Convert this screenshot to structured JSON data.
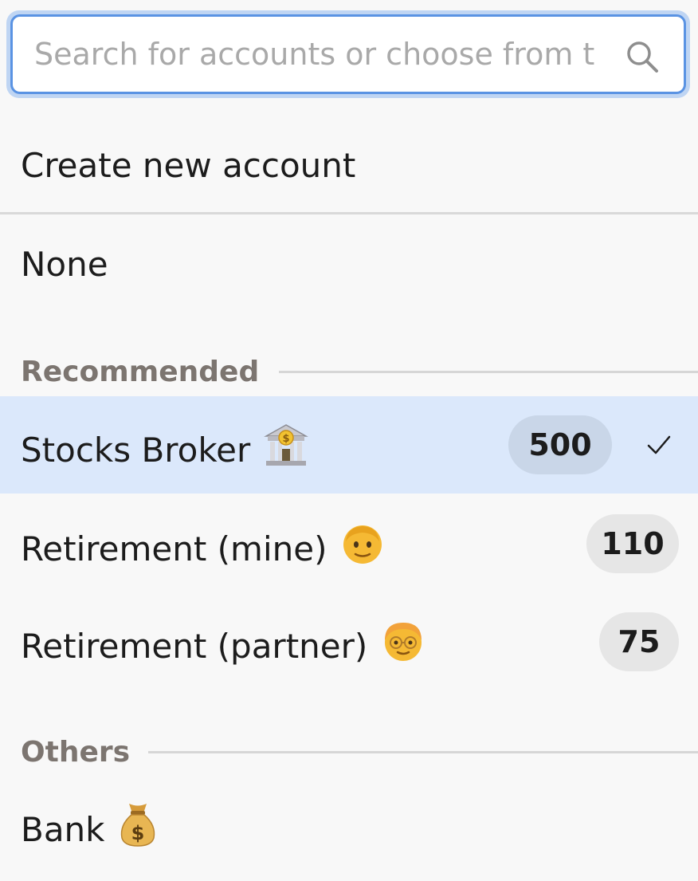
{
  "search": {
    "placeholder": "Search for accounts or choose from t"
  },
  "create_new": {
    "label": "Create new account"
  },
  "none_option": {
    "label": "None"
  },
  "sections": {
    "recommended": {
      "label": "Recommended",
      "items": [
        {
          "label": "Stocks Broker",
          "emoji": "bank-icon",
          "count": "500",
          "selected": true
        },
        {
          "label": "Retirement (mine)",
          "emoji": "older-man-icon",
          "count": "110",
          "selected": false
        },
        {
          "label": "Retirement (partner)",
          "emoji": "older-person-glasses-icon",
          "count": "75",
          "selected": false
        }
      ]
    },
    "others": {
      "label": "Others",
      "items": [
        {
          "label": "Bank",
          "emoji": "money-bag-icon"
        }
      ]
    }
  },
  "colors": {
    "accent": "#5a93e3",
    "selected_row": "#dbe8fb",
    "section_label": "#7c7570"
  }
}
